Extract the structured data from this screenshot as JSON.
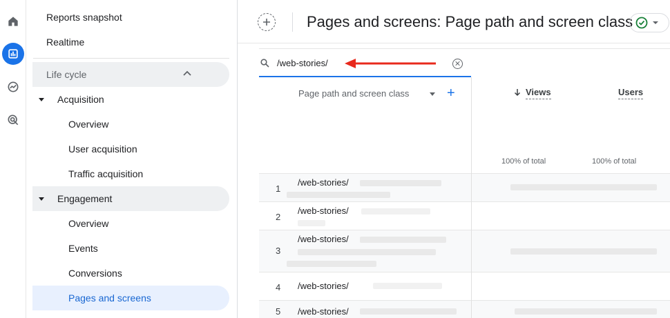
{
  "rail": {
    "icons": [
      "home-icon",
      "reports-icon",
      "explore-icon",
      "advertising-icon"
    ]
  },
  "nav": {
    "reports_snapshot": "Reports snapshot",
    "realtime": "Realtime",
    "lifecycle": "Life cycle",
    "acquisition": "Acquisition",
    "acquisition_items": [
      "Overview",
      "User acquisition",
      "Traffic acquisition"
    ],
    "engagement": "Engagement",
    "engagement_items": [
      "Overview",
      "Events",
      "Conversions",
      "Pages and screens"
    ]
  },
  "header": {
    "title": "Pages and screens: Page path and screen class"
  },
  "search": {
    "value": "/web-stories/"
  },
  "table": {
    "dimension_header": "Page path and screen class",
    "add_dimension": "+",
    "metrics": [
      {
        "label": "Views",
        "total": "100% of total"
      },
      {
        "label": "Users",
        "total": "100% of total"
      }
    ],
    "rows": [
      {
        "num": "1",
        "path": "/web-stories/"
      },
      {
        "num": "2",
        "path": "/web-stories/"
      },
      {
        "num": "3",
        "path": "/web-stories/"
      },
      {
        "num": "4",
        "path": "/web-stories/"
      },
      {
        "num": "5",
        "path": "/web-stories/"
      }
    ]
  },
  "colors": {
    "accent": "#1a73e8",
    "annotation_arrow": "#e8291c",
    "status_ok": "#188038"
  }
}
